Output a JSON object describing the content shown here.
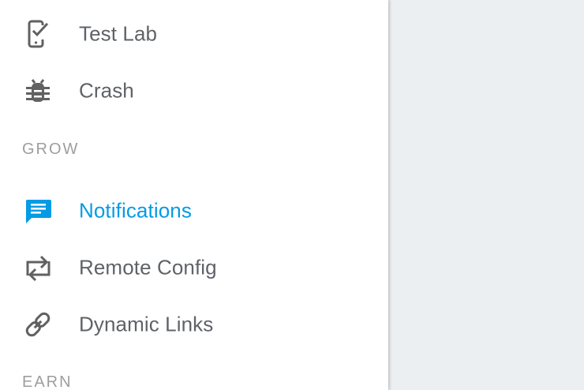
{
  "sidebar": {
    "items": [
      {
        "label": "Test Lab",
        "icon": "phone-check-icon",
        "active": false
      },
      {
        "label": "Crash",
        "icon": "bug-icon",
        "active": false
      },
      {
        "label": "Notifications",
        "icon": "message-icon",
        "active": true
      },
      {
        "label": "Remote Config",
        "icon": "swap-arrows-icon",
        "active": false
      },
      {
        "label": "Dynamic Links",
        "icon": "link-icon",
        "active": false
      }
    ],
    "sections": {
      "grow": "GROW",
      "earn": "EARN"
    }
  },
  "colors": {
    "text": "#5f6368",
    "icon": "#616161",
    "active": "#039be5",
    "section_header": "#9e9e9e",
    "sidebar_bg": "#ffffff",
    "content_bg": "#eceff1"
  }
}
